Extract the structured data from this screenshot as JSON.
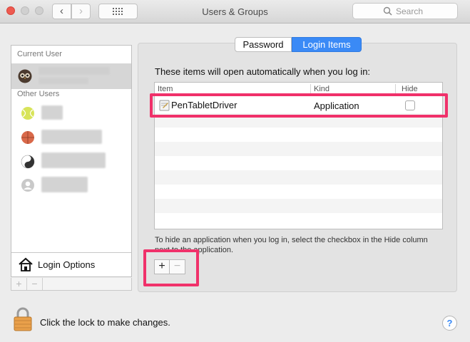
{
  "window": {
    "title": "Users & Groups",
    "search_placeholder": "Search",
    "back_glyph": "‹",
    "forward_glyph": "›"
  },
  "sidebar": {
    "current_user_label": "Current User",
    "other_users_label": "Other Users",
    "login_options_label": "Login Options",
    "add_glyph": "+",
    "remove_glyph": "−"
  },
  "tabs": [
    {
      "label": "Password",
      "selected": false
    },
    {
      "label": "Login Items",
      "selected": true
    }
  ],
  "login_items": {
    "intro": "These items will open automatically when you log in:",
    "columns": [
      "Item",
      "Kind",
      "Hide"
    ],
    "rows": [
      {
        "item": "PenTabletDriver",
        "kind": "Application",
        "hide": false
      }
    ],
    "hint": "To hide an application when you log in, select the checkbox in the Hide column next to the application.",
    "add_glyph": "+",
    "remove_glyph": "−"
  },
  "footer": {
    "lock_text": "Click the lock to make changes.",
    "help_glyph": "?"
  },
  "colors": {
    "accent": "#3a8af6",
    "highlight": "#f0316a"
  }
}
